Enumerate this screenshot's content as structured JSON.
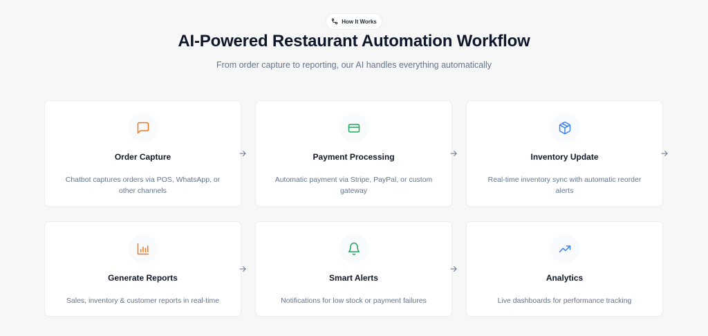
{
  "badge": {
    "label": "How It Works",
    "icon": "workflow-icon"
  },
  "header": {
    "title": "AI-Powered Restaurant Automation Workflow",
    "subtitle": "From order capture to reporting, our AI handles everything automatically"
  },
  "colors": {
    "orange": "#f97316",
    "green": "#22a55a",
    "blue": "#3b82f6",
    "arrow": "#64748b"
  },
  "steps": [
    {
      "title": "Order Capture",
      "description": "Chatbot captures orders via POS, WhatsApp, or other channels",
      "icon": "message-square-icon"
    },
    {
      "title": "Payment Processing",
      "description": "Automatic payment via Stripe, PayPal, or custom gateway",
      "icon": "credit-card-icon"
    },
    {
      "title": "Inventory Update",
      "description": "Real-time inventory sync with automatic reorder alerts",
      "icon": "package-icon"
    },
    {
      "title": "Generate Reports",
      "description": "Sales, inventory & customer reports in real-time",
      "icon": "bar-chart-icon"
    },
    {
      "title": "Smart Alerts",
      "description": "Notifications for low stock or payment failures",
      "icon": "bell-icon"
    },
    {
      "title": "Analytics",
      "description": "Live dashboards for performance tracking",
      "icon": "trending-up-icon"
    }
  ]
}
